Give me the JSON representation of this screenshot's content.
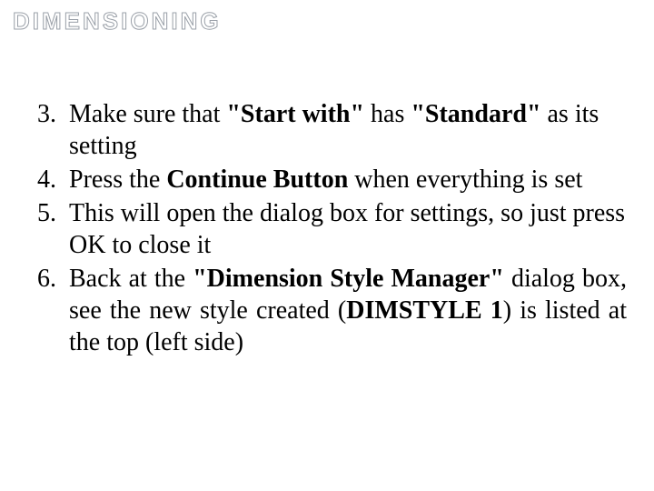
{
  "title": "DIMENSIONING",
  "items": [
    {
      "num": "3.",
      "pre": "Make sure that ",
      "b1": "\"Start with\"",
      "mid": " has ",
      "b2": "\"Standard\"",
      "post": " as  its setting"
    },
    {
      "num": "4.",
      "pre": "Press the ",
      "b1": "Continue Button",
      "post": " when everything is set"
    },
    {
      "num": "5.",
      "text": "This will open the dialog box for settings, so  just press OK to close it"
    },
    {
      "num": "6.",
      "pre": "Back at the ",
      "b1": "\"Dimension Style Manager\"",
      "mid": " dialog box, see the new style created (",
      "b2": "DIMSTYLE 1",
      "post": ") is  listed at the top (left side)"
    }
  ]
}
